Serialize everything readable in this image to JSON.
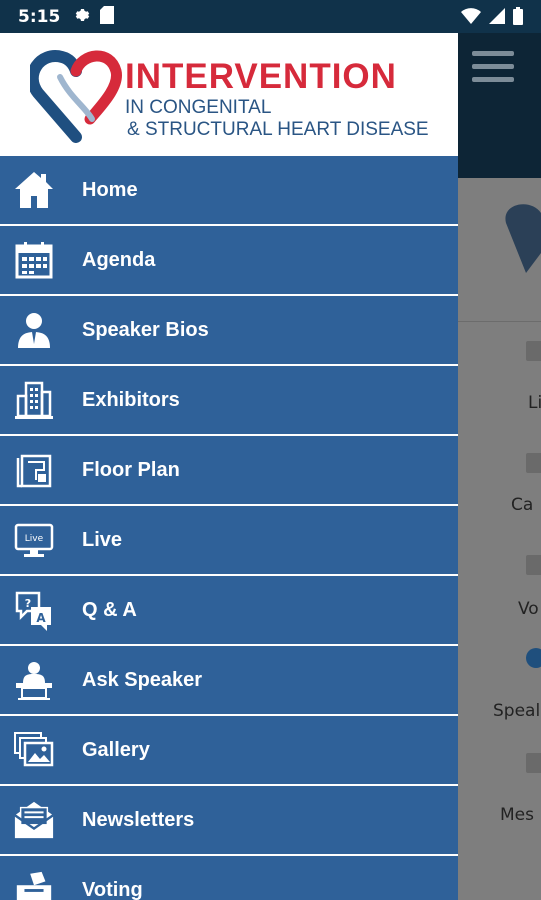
{
  "status_bar": {
    "time": "5:15",
    "icons": [
      "gear-icon",
      "sd-card-icon",
      "wifi-icon",
      "signal-icon",
      "battery-icon"
    ]
  },
  "app": {
    "logo": {
      "title": "INTERVENTION",
      "line1": "IN CONGENITAL",
      "line2": "& STRUCTURAL HEART DISEASE"
    },
    "colors": {
      "menu_bg": "#2f6199",
      "brand_red": "#d62a3b",
      "brand_blue": "#2a5584"
    }
  },
  "menu": [
    {
      "label": "Home",
      "icon": "home-icon"
    },
    {
      "label": "Agenda",
      "icon": "calendar-icon"
    },
    {
      "label": "Speaker Bios",
      "icon": "speaker-icon"
    },
    {
      "label": "Exhibitors",
      "icon": "building-icon"
    },
    {
      "label": "Floor Plan",
      "icon": "floor-plan-icon"
    },
    {
      "label": "Live",
      "icon": "live-monitor-icon",
      "icon_text": "Live"
    },
    {
      "label": "Q & A",
      "icon": "qa-icon",
      "icon_text": "A"
    },
    {
      "label": "Ask Speaker",
      "icon": "podium-icon"
    },
    {
      "label": "Gallery",
      "icon": "gallery-icon"
    },
    {
      "label": "Newsletters",
      "icon": "newsletter-icon"
    },
    {
      "label": "Voting",
      "icon": "voting-icon"
    }
  ],
  "background": {
    "items": [
      "Li",
      "Ca",
      "Vo",
      "Speal",
      "Mes"
    ]
  }
}
